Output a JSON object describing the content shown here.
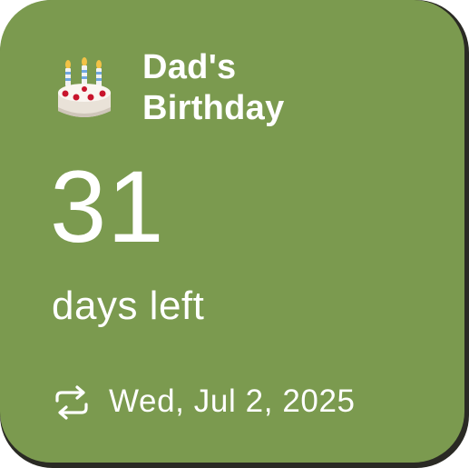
{
  "widget": {
    "title": "Dad's\nBirthday",
    "icon": "birthday-cake-icon",
    "count": "31",
    "count_label": "days left",
    "repeat_icon": "repeat-icon",
    "date": "Wed, Jul 2, 2025",
    "background_color": "#7b9a4f"
  }
}
